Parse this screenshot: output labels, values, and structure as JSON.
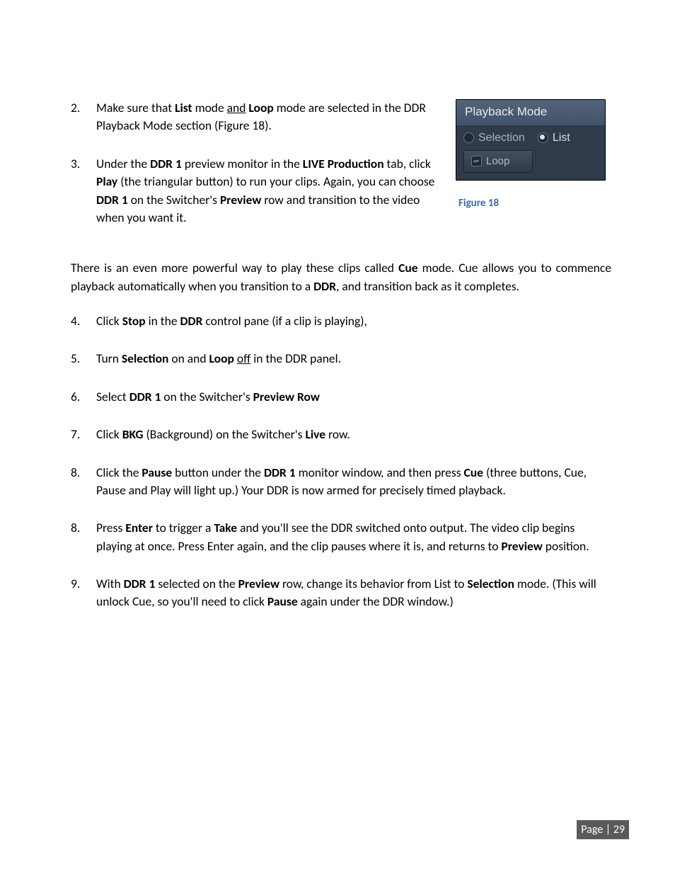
{
  "figure": {
    "panel_title": "Playback Mode",
    "opt_selection": "Selection",
    "opt_list": "List",
    "opt_loop": "Loop",
    "caption": "Figure 18"
  },
  "items": {
    "n2": "2.",
    "t2_a": "Make sure that ",
    "t2_b": "List",
    "t2_c": " mode ",
    "t2_d": "and",
    "t2_e": " ",
    "t2_f": "Loop",
    "t2_g": " mode are selected in the DDR Playback Mode section (Figure 18).",
    "n3": "3.",
    "t3_a": " Under the ",
    "t3_b": "DDR 1",
    "t3_c": " preview monitor in the ",
    "t3_d": "LIVE Production",
    "t3_e": " tab, click ",
    "t3_f": "Play",
    "t3_g": " (the triangular button) to run your clips.  Again, you can choose ",
    "t3_h": "DDR 1",
    "t3_i": " on the Switcher's ",
    "t3_j": "Preview",
    "t3_k": " row and transition to the video when you want it.",
    "para_a": "There is an even more powerful way to play these clips called ",
    "para_b": "Cue",
    "para_c": " mode.  Cue allows you to commence playback automatically when you transition to a ",
    "para_d": "DDR",
    "para_e": ", and transition back as it completes.",
    "n4": "4.",
    "t4_a": "Click ",
    "t4_b": "Stop",
    "t4_c": " in the ",
    "t4_d": "DDR",
    "t4_e": " control pane (if a clip is playing),",
    "n5": "5.",
    "t5_a": "Turn ",
    "t5_b": "Selection",
    "t5_c": " on and ",
    "t5_d": "Loop",
    "t5_e": " ",
    "t5_f": "off",
    "t5_g": " in the DDR panel.",
    "n6": "6.",
    "t6_a": " Select ",
    "t6_b": "DDR 1",
    "t6_c": " on the Switcher's ",
    "t6_d": "Preview Row",
    "n7": "7.",
    "t7_a": "Click ",
    "t7_b": "BKG",
    "t7_c": " (Background) on the Switcher's ",
    "t7_d": "Live",
    "t7_e": " row.",
    "n8": "8.",
    "t8_a": "Click the ",
    "t8_b": "Pause",
    "t8_c": " button under the ",
    "t8_d": "DDR 1",
    "t8_e": " monitor window, and then press ",
    "t8_f": "Cue",
    "t8_g": " (three buttons, Cue, Pause and Play will light up.) Your DDR is now armed for precisely timed playback.",
    "n8b": "8.",
    "t8b_a": "Press ",
    "t8b_b": "Enter",
    "t8b_c": " to trigger a ",
    "t8b_d": "Take",
    "t8b_e": " and you'll see the DDR switched onto output.  The video clip begins playing at once.  Press Enter again, and the clip pauses where it is, and returns to ",
    "t8b_f": "Preview",
    "t8b_g": " position.",
    "n9": "9.",
    "t9_a": "With ",
    "t9_b": "DDR 1",
    "t9_c": " selected on the ",
    "t9_d": "Preview",
    "t9_e": " row, change its behavior from List to ",
    "t9_f": "Selection",
    "t9_g": " mode. (This will unlock Cue, so you'll need to click ",
    "t9_h": "Pause",
    "t9_i": " again under the DDR window.)"
  },
  "footer": "Page | 29"
}
